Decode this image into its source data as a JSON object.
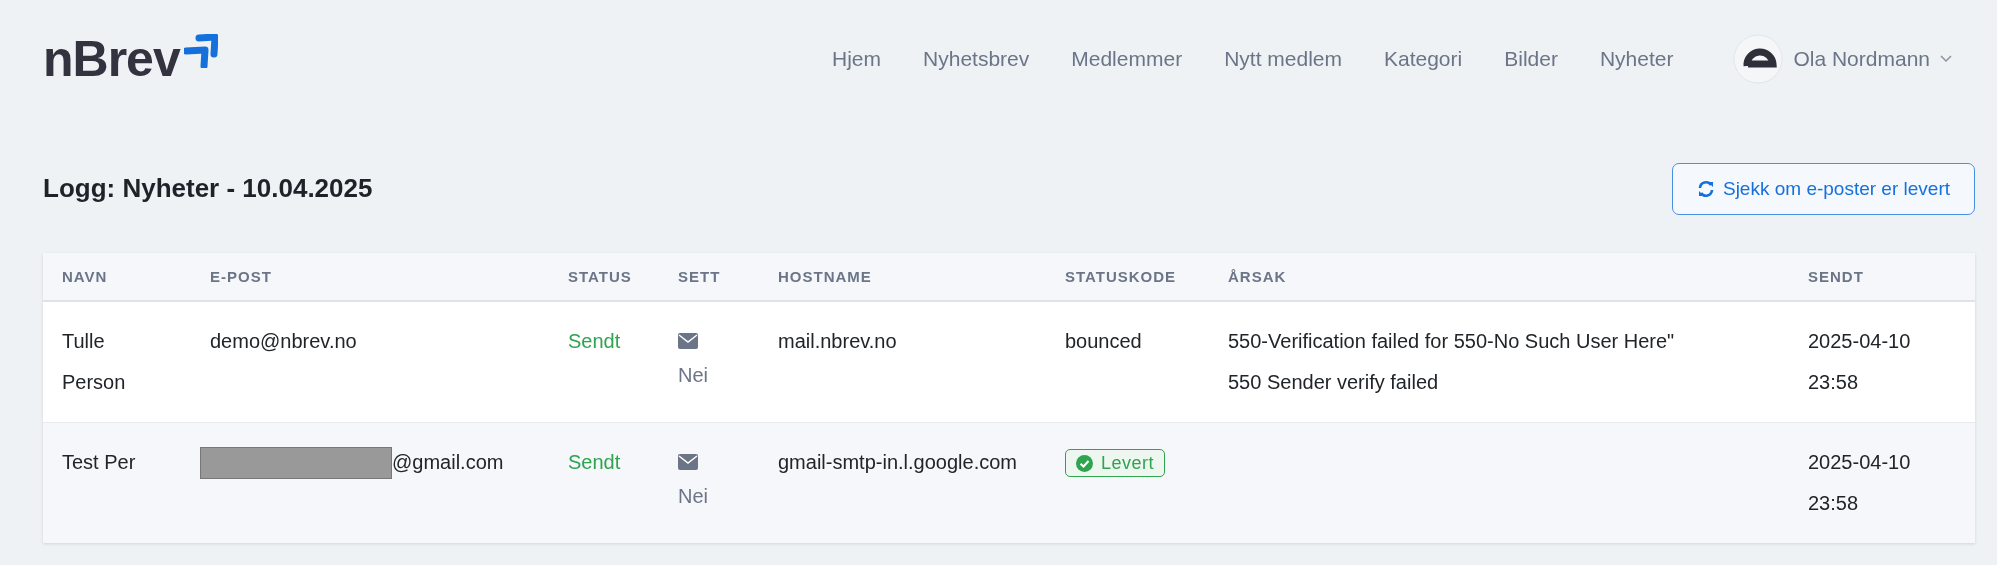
{
  "brand": {
    "name": "nBrev"
  },
  "nav": [
    {
      "label": "Hjem"
    },
    {
      "label": "Nyhetsbrev"
    },
    {
      "label": "Medlemmer"
    },
    {
      "label": "Nytt medlem"
    },
    {
      "label": "Kategori"
    },
    {
      "label": "Bilder"
    },
    {
      "label": "Nyheter"
    }
  ],
  "user": {
    "name": "Ola Nordmann"
  },
  "page": {
    "title": "Logg: Nyheter - 10.04.2025",
    "action_button": "Sjekk om e-poster er levert"
  },
  "table": {
    "columns": [
      "NAVN",
      "E-POST",
      "STATUS",
      "SETT",
      "HOSTNAME",
      "STATUSKODE",
      "ÅRSAK",
      "SENDT"
    ],
    "rows": [
      {
        "name": "Tulle Person",
        "email": "demo@nbrev.no",
        "email_redacted": false,
        "status": "Sendt",
        "seen": "Nei",
        "hostname": "mail.nbrev.no",
        "status_code": {
          "kind": "text",
          "label": "bounced"
        },
        "reason": "550-Verification failed for 550-No Such User Here\" 550 Sender verify failed",
        "sent": "2025-04-10 23:58"
      },
      {
        "name": "Test Per",
        "email": "@gmail.com",
        "email_redacted": true,
        "status": "Sendt",
        "seen": "Nei",
        "hostname": "gmail-smtp-in.l.google.com",
        "status_code": {
          "kind": "badge",
          "label": "Levert"
        },
        "sent": "2025-04-10 23:58"
      }
    ]
  }
}
